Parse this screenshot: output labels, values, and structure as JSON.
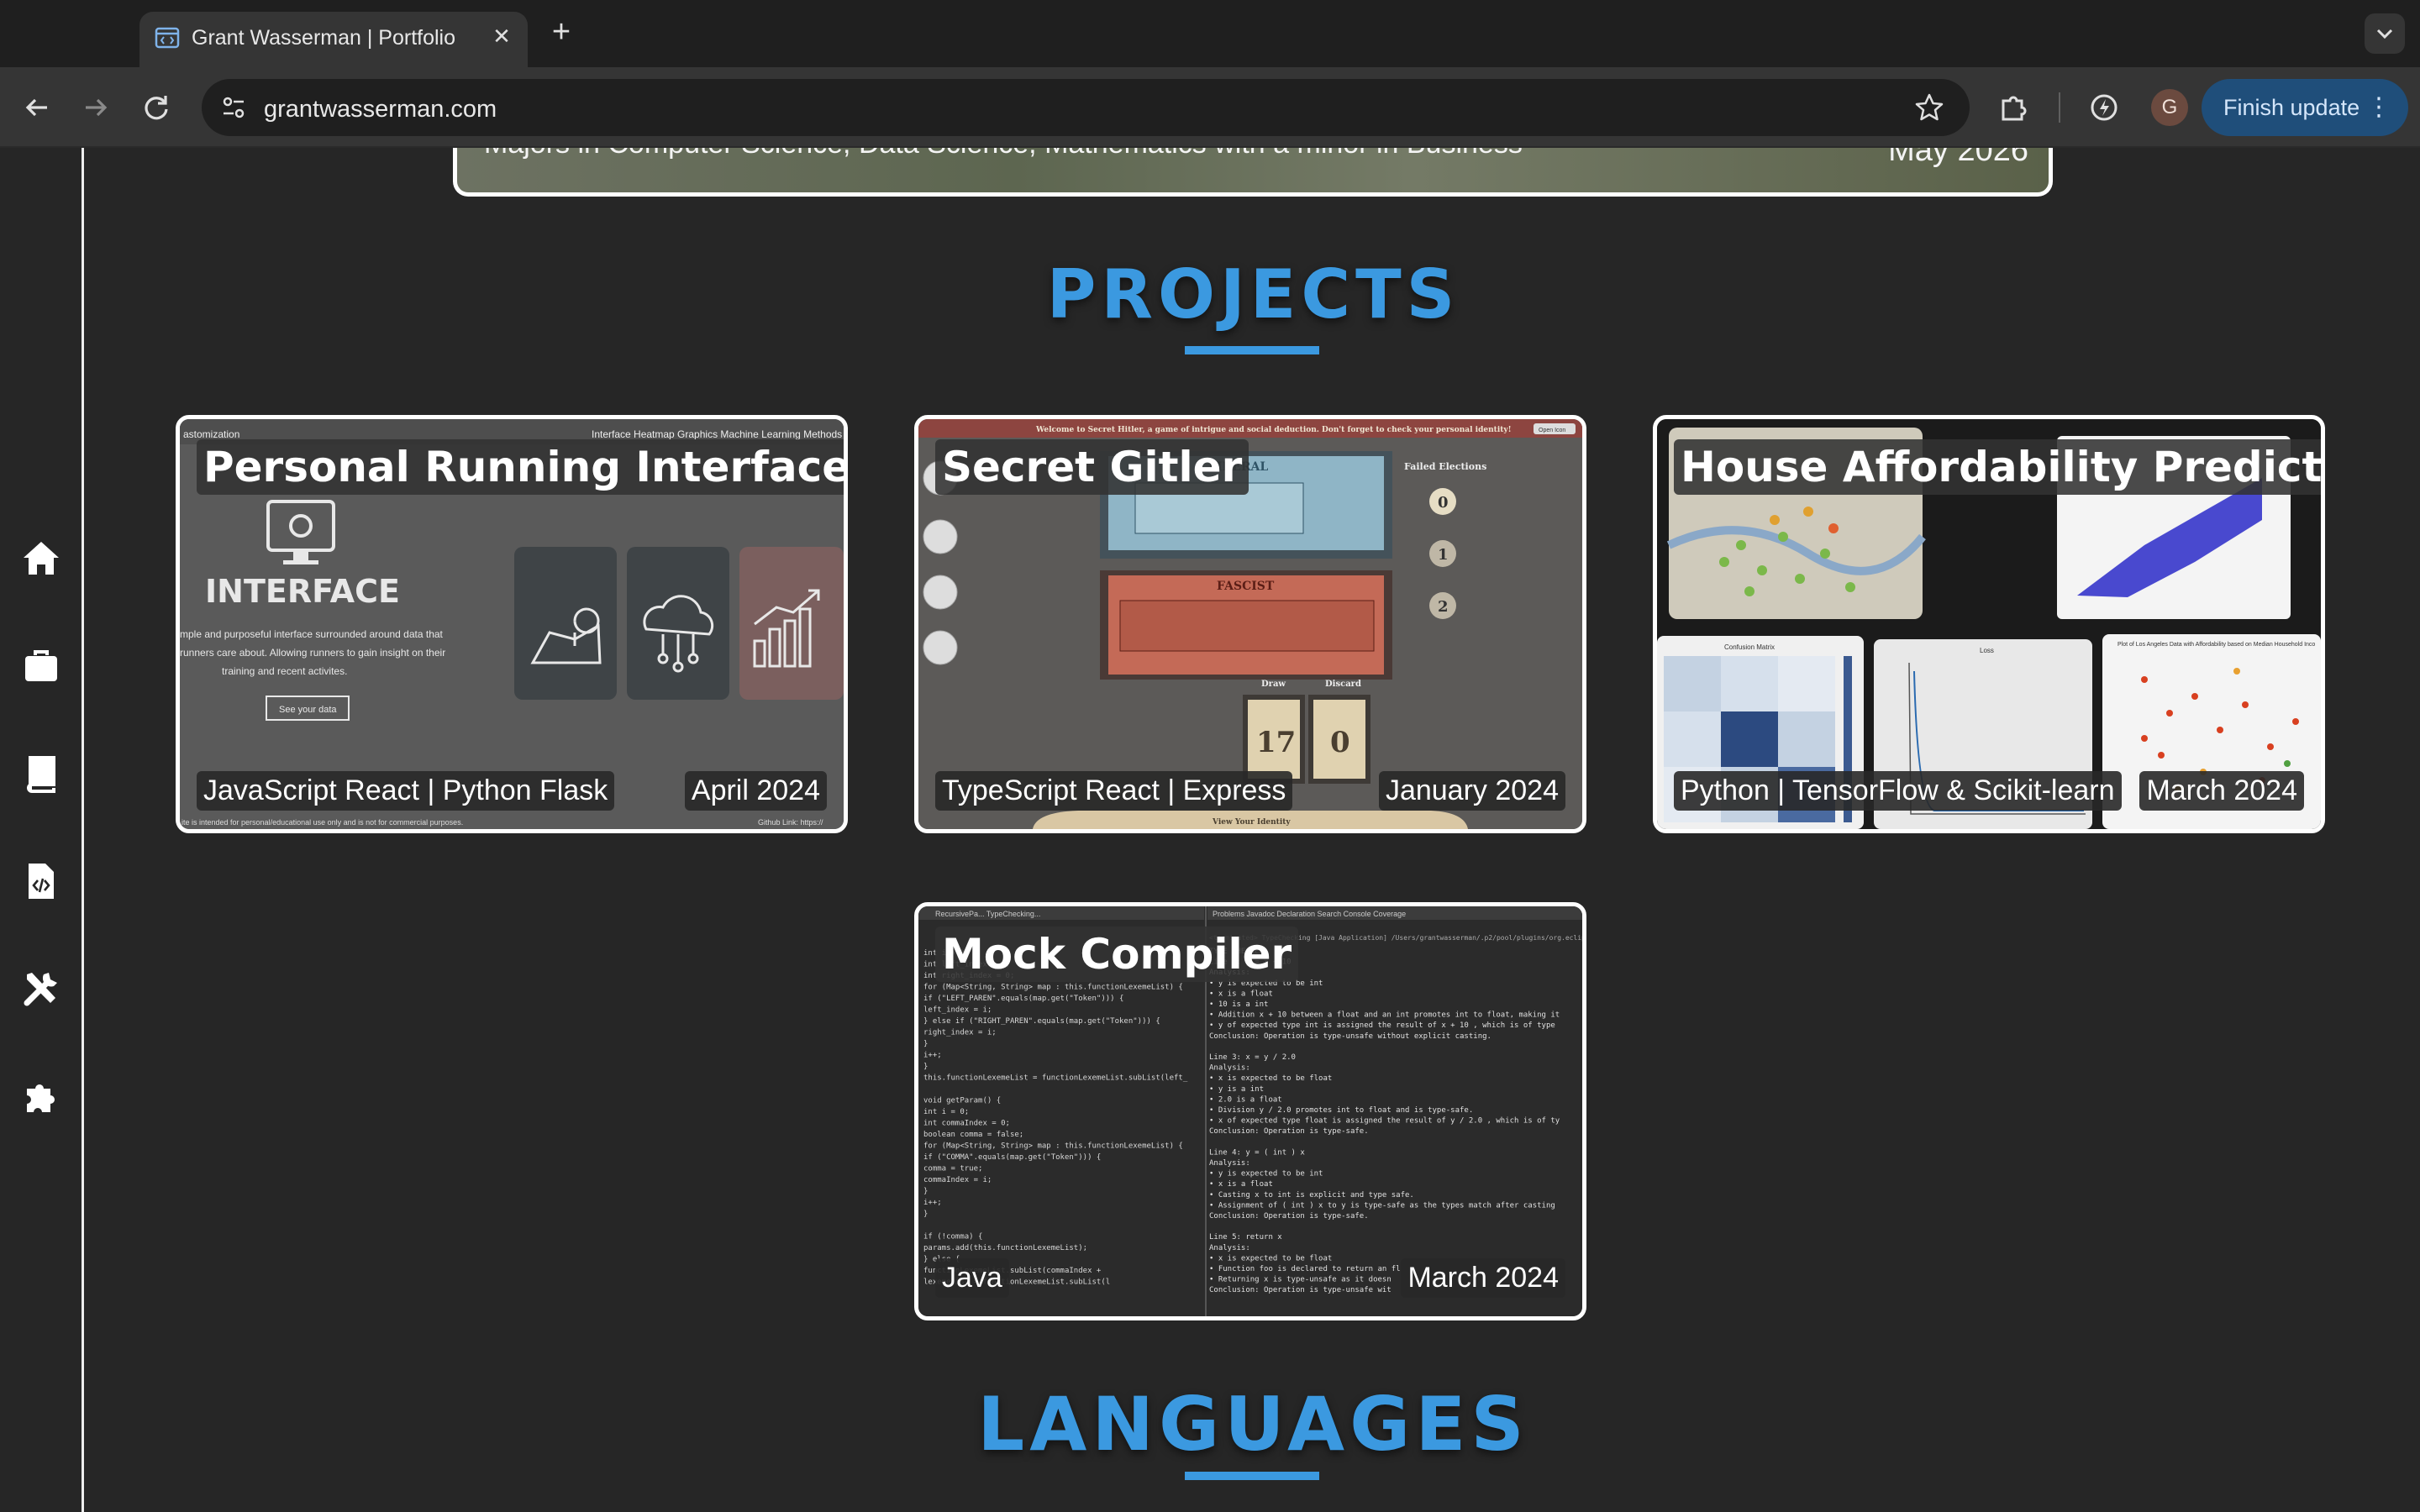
{
  "browser": {
    "tab_title": "Grant Wasserman | Portfolio",
    "url": "grantwasserman.com",
    "avatar_letter": "G",
    "finish_update_label": "Finish update"
  },
  "sidebar": {
    "items": [
      {
        "icon": "home-icon"
      },
      {
        "icon": "briefcase-icon"
      },
      {
        "icon": "book-icon"
      },
      {
        "icon": "code-file-icon"
      },
      {
        "icon": "tools-icon"
      },
      {
        "icon": "puzzle-icon"
      }
    ]
  },
  "education": {
    "majors": "Majors in Computer Science, Data Science, Mathematics with a minor in Business",
    "date": "May 2026"
  },
  "projects": {
    "heading": "PROJECTS",
    "cards": [
      {
        "title": "Personal Running Interface",
        "tech": "JavaScript React | Python Flask",
        "date": "April 2024",
        "thumb": {
          "nav_brand": "astomization",
          "nav_links": "Interface  Heatmap  Graphics  Machine Learning  Methods",
          "hero_word": "INTERFACE",
          "hero_text_1": "mple and purposeful interface surrounded around data that",
          "hero_text_2": "runners care about. Allowing runners to gain insight on their",
          "hero_text_3": "training and recent activites.",
          "hero_button": "See your data",
          "footer_left": "ite is intended for personal/educational use only and is not for commercial purposes.",
          "footer_right": "Github Link: https://"
        }
      },
      {
        "title": "Secret Gitler",
        "tech": "TypeScript React | Express",
        "date": "January 2024",
        "thumb": {
          "banner": "Welcome to Secret Hitler, a game of intrigue and social deduction. Don't forget to check your personal identity!",
          "banner_btn": "Open Icon",
          "liberal": "LIBERAL",
          "fascist": "FASCIST",
          "failed_elections": "Failed Elections",
          "counters": [
            "0",
            "1",
            "2"
          ],
          "draw_label": "Draw",
          "discard_label": "Discard",
          "draw_count": "17",
          "discard_count": "0",
          "view_identity": "View Your Identity"
        }
      },
      {
        "title": "House Affordability Predictor",
        "tech": "Python | TensorFlow & Scikit-learn",
        "date": "March 2024",
        "thumb": {
          "confusion_title": "Confusion Matrix",
          "loss_title": "Loss",
          "scatter_title": "Plot of Los Angeles Data with Affordability based on Median Household Inco"
        }
      },
      {
        "title": "Mock Compiler",
        "tech": "Java",
        "date": "March 2024",
        "thumb": {
          "tabs": "RecursivePa...  TypeChecking...",
          "console_tabs": "Problems  Javadoc  Declaration  Search  Console  Coverage",
          "console_header": "<terminated> TypeChecking [Java Application] /Users/grantwasserman/.p2/pool/plugins/org.eclipse.justj.o",
          "code_lines": [
            "int i = 0;",
            "int left_index = 0;",
            "int right_index = 0;",
            "for (Map<String, String> map : this.functionLexemeList) {",
            "  if (\"LEFT_PAREN\".equals(map.get(\"Token\"))) {",
            "    left_index = i;",
            "  } else if (\"RIGHT_PAREN\".equals(map.get(\"Token\"))) {",
            "    right_index = i;",
            "  }",
            "  i++;",
            "}",
            "this.functionLexemeList = functionLexemeList.subList(left_",
            "",
            "void getParam() {",
            "int i = 0;",
            "int commaIndex = 0;",
            "boolean comma = false;",
            "for (Map<String, String> map : this.functionLexemeList) {",
            "  if (\"COMMA\".equals(map.get(\"Token\"))) {",
            "    comma = true;",
            "    commaIndex = i;",
            "  }",
            "  i++;",
            "}",
            "",
            "if (!comma) {",
            "  params.add(this.functionLexemeList);",
            "} else {",
            "  functionLexemeList.subList(commaIndex +",
            "  lexemeList = functionLexemeList.subList(l"
          ],
          "console_lines": [
            "TYPE CHECKER",
            "Line 2: y = x + 10",
            "Analysis:",
            "• y is expected to be int",
            "• x is a float",
            "• 10 is a int",
            "• Addition x + 10 between a float and an int promotes int to float, making it",
            "• y of expected type int is assigned the result of x + 10 , which is of type",
            "Conclusion: Operation is type-unsafe without explicit casting.",
            "",
            "Line 3: x = y / 2.0",
            "Analysis:",
            "• x is expected to be float",
            "• y is a int",
            "• 2.0 is a float",
            "• Division y / 2.0 promotes int to float and is type-safe.",
            "• x of expected type float is assigned the result of y / 2.0 , which is of ty",
            "Conclusion: Operation is type-safe.",
            "",
            "Line 4: y = ( int ) x",
            "Analysis:",
            "• y is expected to be int",
            "• x is a float",
            "• Casting x to int is explicit and type safe.",
            "• Assignment of ( int ) x  to y is type-safe as the types match after casting",
            "Conclusion: Operation is type-safe.",
            "",
            "Line 5: return x",
            "Analysis:",
            "• x is expected to be float",
            "• Function foo is declared to return an fl",
            "• Returning x is type-unsafe as it doesn",
            "Conclusion: Operation is type-unsafe wit"
          ]
        }
      }
    ]
  },
  "languages": {
    "heading": "LANGUAGES"
  },
  "colors": {
    "accent": "#3b99e0",
    "background": "#262626",
    "card_border": "#ffffff"
  }
}
